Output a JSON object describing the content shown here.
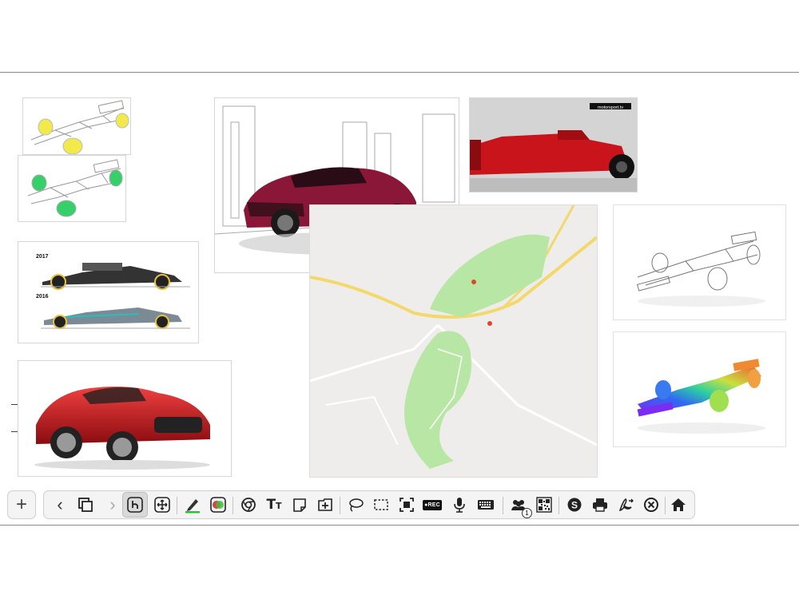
{
  "canvas": {
    "images": [
      {
        "name": "f1-sketch-yellow-wheels"
      },
      {
        "name": "f1-sketch-green-wheels"
      },
      {
        "name": "f1-2017-vs-2016-comparison",
        "label_top": "2017",
        "label_bottom": "2016"
      },
      {
        "name": "red-sports-car"
      },
      {
        "name": "maroon-concept-car-city-sketch"
      },
      {
        "name": "ferrari-f1-car-photo",
        "watermark": "motorsport.tv"
      },
      {
        "name": "nurburgring-map"
      },
      {
        "name": "f1-wireframe-sketch"
      },
      {
        "name": "f1-rainbow-heatmap-render"
      }
    ]
  },
  "toolbar": {
    "add": {
      "label": "+",
      "icon": "plus-icon"
    },
    "buttons": [
      {
        "name": "back-button",
        "icon": "chevron-left-icon",
        "glyph": "‹"
      },
      {
        "name": "duplicate-button",
        "icon": "copy-pages-icon"
      },
      {
        "name": "forward-button",
        "icon": "chevron-right-icon",
        "glyph": "›"
      },
      {
        "name": "select-tool-button",
        "icon": "pointer-hand-icon"
      },
      {
        "name": "move-tool-button",
        "icon": "move-arrows-icon"
      },
      {
        "name": "pen-tool-button",
        "icon": "pencil-icon",
        "accent": "#2dbf3a"
      },
      {
        "name": "color-picker-button",
        "icon": "color-circles-icon"
      },
      {
        "name": "browser-button",
        "icon": "chrome-icon"
      },
      {
        "name": "text-tool-button",
        "icon": "text-size-icon",
        "glyph": "T",
        "glyph_small": "T"
      },
      {
        "name": "sticky-note-button",
        "icon": "note-icon"
      },
      {
        "name": "add-page-button",
        "icon": "add-folder-icon"
      },
      {
        "name": "lasso-button",
        "icon": "lasso-icon"
      },
      {
        "name": "rect-select-button",
        "icon": "dashed-rectangle-icon"
      },
      {
        "name": "screen-capture-button",
        "icon": "screen-capture-icon"
      },
      {
        "name": "record-button",
        "icon": "rec-icon",
        "label": "●REC"
      },
      {
        "name": "microphone-button",
        "icon": "microphone-icon"
      },
      {
        "name": "keyboard-button",
        "icon": "keyboard-icon"
      },
      {
        "name": "participants-button",
        "icon": "people-icon",
        "badge": "1"
      },
      {
        "name": "qr-code-button",
        "icon": "qr-code-icon"
      },
      {
        "name": "skype-button",
        "icon": "skype-icon",
        "glyph": "S"
      },
      {
        "name": "print-button",
        "icon": "printer-icon"
      },
      {
        "name": "export-pdf-button",
        "icon": "pdf-export-icon"
      },
      {
        "name": "close-button",
        "icon": "close-circle-icon"
      },
      {
        "name": "home-button",
        "icon": "home-icon"
      }
    ]
  },
  "colors": {
    "toolbar_bg": "#f4f4f4",
    "toolbar_border": "#cfcfcf",
    "pen_accent": "#2dbf3a",
    "ferrari_red": "#c8141a",
    "map_green": "#b8e6a4"
  }
}
